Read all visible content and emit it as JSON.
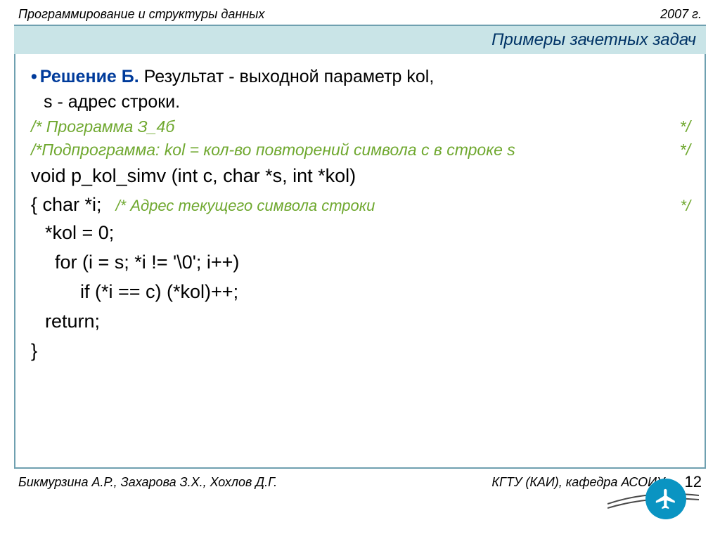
{
  "header": {
    "left": "Программирование  и структуры данных",
    "right": "2007 г."
  },
  "title": "Примеры зачетных задач",
  "body": {
    "bullet": "•",
    "solution_label": "Решение Б.",
    "solution_rest": " Результат - выходной параметр kol,",
    "line2": "s - адрес строки.",
    "comment1_left": "/* Программа З_4б",
    "comment1_right": "*/",
    "comment2_left": "/*Подпрограмма: kol = кол-во повторений символа c в строке s",
    "comment2_right": "*/",
    "sig": "void p_kol_simv (int c, char *s, int *kol)",
    "chari_left": "{  char *i;",
    "chari_mid": "/* Адрес текущего символа строки",
    "chari_right": "*/",
    "kol0": "*kol = 0;",
    "forline": "for (i = s; *i != '\\0'; i++)",
    "ifline": "if (*i == c)  (*kol)++;",
    "ret": "return;",
    "brace": "}"
  },
  "footer": {
    "left": "Бикмурзина А.Р., Захарова З.Х., Хохлов Д.Г.",
    "center": "КГТУ  (КАИ),  кафедра АСОИУ",
    "page": "12"
  }
}
